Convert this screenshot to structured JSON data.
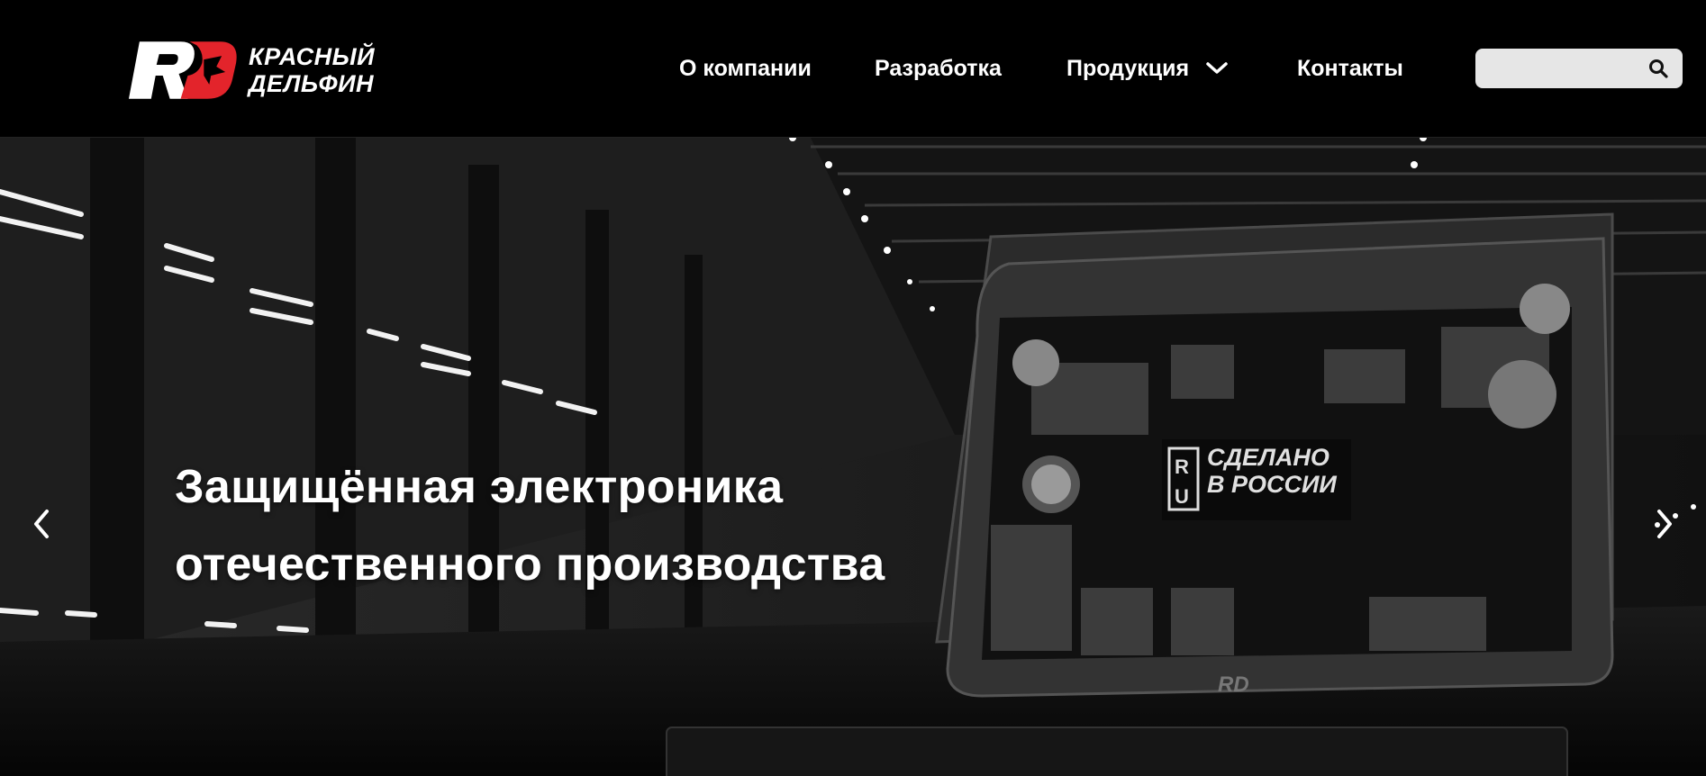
{
  "header": {
    "logo": {
      "text_line1": "КРАСНЫЙ",
      "text_line2": "ДЕЛЬФИН",
      "mark_text": "RD",
      "brand_color": "#e3242b"
    },
    "nav": {
      "about": "О компании",
      "development": "Разработка",
      "products": "Продукция",
      "contacts": "Контакты"
    },
    "search": {
      "placeholder": "",
      "icon": "search-icon"
    }
  },
  "hero": {
    "title_line1": "Защищённая электроника",
    "title_line2": "отечественного производства",
    "screen_badge": {
      "line1": "СДЕЛАНО",
      "line2": "В РОССИИ",
      "mark_letters": "RU"
    },
    "laptop_logo": "RD",
    "prev_icon": "chevron-left-icon",
    "next_icon": "chevron-right-icon"
  }
}
